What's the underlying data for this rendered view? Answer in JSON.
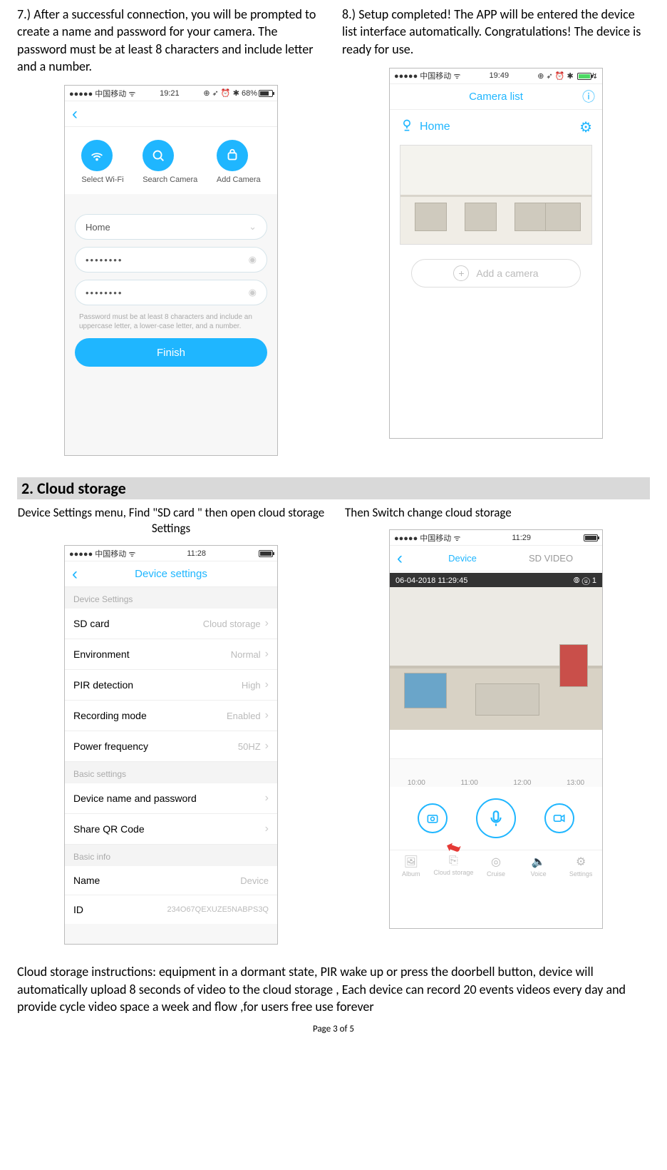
{
  "step7": {
    "text": "7.) After a successful connection, you will be prompted to create a name and password for your camera. The password must be at least 8 characters and include letter and a number.",
    "statusbar": {
      "carrier": "中国移动",
      "time": "19:21",
      "battery": "68%"
    },
    "steps": {
      "wifi": "Select Wi-Fi",
      "search": "Search Camera",
      "add": "Add Camera"
    },
    "nameValue": "Home",
    "pwd1": "••••••••",
    "pwd2": "••••••••",
    "hint": "Password must be at least 8 characters and include an uppercase letter, a lower-case letter, and a number.",
    "finish": "Finish"
  },
  "step8": {
    "text": "8.) Setup completed!  The APP will be entered the device list interface automatically. Congratulations! The device is ready for use.",
    "statusbar": {
      "carrier": "中国移动",
      "time": "19:49"
    },
    "navTitle": "Camera list",
    "homeLabel": "Home",
    "addCamera": "Add a camera"
  },
  "section2": {
    "title": "2. Cloud storage",
    "leftCaption": "Device Settings menu, Find  \"SD card \" then open cloud storage Settings",
    "rightCaption": "Then Switch change cloud storage"
  },
  "deviceSettings": {
    "statusbar": {
      "carrier": "中国移动",
      "time": "11:28"
    },
    "navTitle": "Device settings",
    "grp1": "Device Settings",
    "rows1": [
      {
        "label": "SD card",
        "value": "Cloud storage"
      },
      {
        "label": "Environment",
        "value": "Normal"
      },
      {
        "label": "PIR detection",
        "value": "High"
      },
      {
        "label": "Recording mode",
        "value": "Enabled"
      },
      {
        "label": "Power frequency",
        "value": "50HZ"
      }
    ],
    "grp2": "Basic settings",
    "rows2": [
      {
        "label": "Device name and password",
        "value": ""
      },
      {
        "label": "Share QR Code",
        "value": ""
      }
    ],
    "grp3": "Basic info",
    "rows3": [
      {
        "label": "Name",
        "value": "Device"
      },
      {
        "label": "ID",
        "value": "234O67QEXUZE5NABPS3Q"
      }
    ]
  },
  "videoView": {
    "statusbar": {
      "carrier": "中国移动",
      "time": "11:29"
    },
    "tabs": {
      "device": "Device",
      "sd": "SD VIDEO"
    },
    "overlayTime": "06-04-2018 11:29:45",
    "overlayCount": "1",
    "timeline": [
      "10:00",
      "11:00",
      "12:00",
      "13:00"
    ],
    "bottom": [
      "Album",
      "Cloud storage",
      "Cruise",
      "Voice",
      "Settings"
    ]
  },
  "cloudInstr": "Cloud storage instructions: equipment in a dormant state, PIR wake up or press the doorbell button, device will automatically upload 8 seconds of video to the cloud storage , Each device can record  20 events  videos every day and provide cycle video space a week  and flow  ,for users free use forever",
  "pageFoot": "Page 3 of 5"
}
